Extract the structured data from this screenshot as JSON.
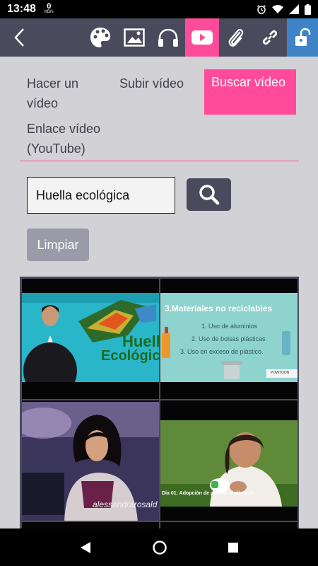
{
  "status_bar": {
    "time": "13:48",
    "net_speed": "0",
    "net_unit": "KB/s"
  },
  "toolbar": {
    "icons": [
      "back-arrow-icon",
      "palette-icon",
      "image-icon",
      "headphones-icon",
      "youtube-icon",
      "paperclip-icon",
      "link-icon",
      "unlock-icon"
    ],
    "accent": "#ff4b9a",
    "bar_color": "#4a4a5c",
    "lock_color": "#3e84c6"
  },
  "tabs": {
    "make_video": "Hacer un vídeo",
    "upload_video": "Subir vídeo",
    "search_video": "Buscar vídeo",
    "youtube_link": "Enlace vídeo (YouTube)"
  },
  "search": {
    "value": "Huella ecológica"
  },
  "clear_label": "Limpiar",
  "results": [
    {
      "title_line1": "Huella",
      "title_line2": "Ecológica"
    },
    {
      "title": "3.Materiales no reciclables",
      "items": [
        "1. Uso de aluminios",
        "2. Uso de bolsas plásticas",
        "3. Uso en exceso de plástico."
      ],
      "brand": "POWTOON"
    },
    {
      "caption": "alessandrarosald"
    },
    {
      "caption": "Día 01: Adopción de plantas endémicas"
    }
  ]
}
